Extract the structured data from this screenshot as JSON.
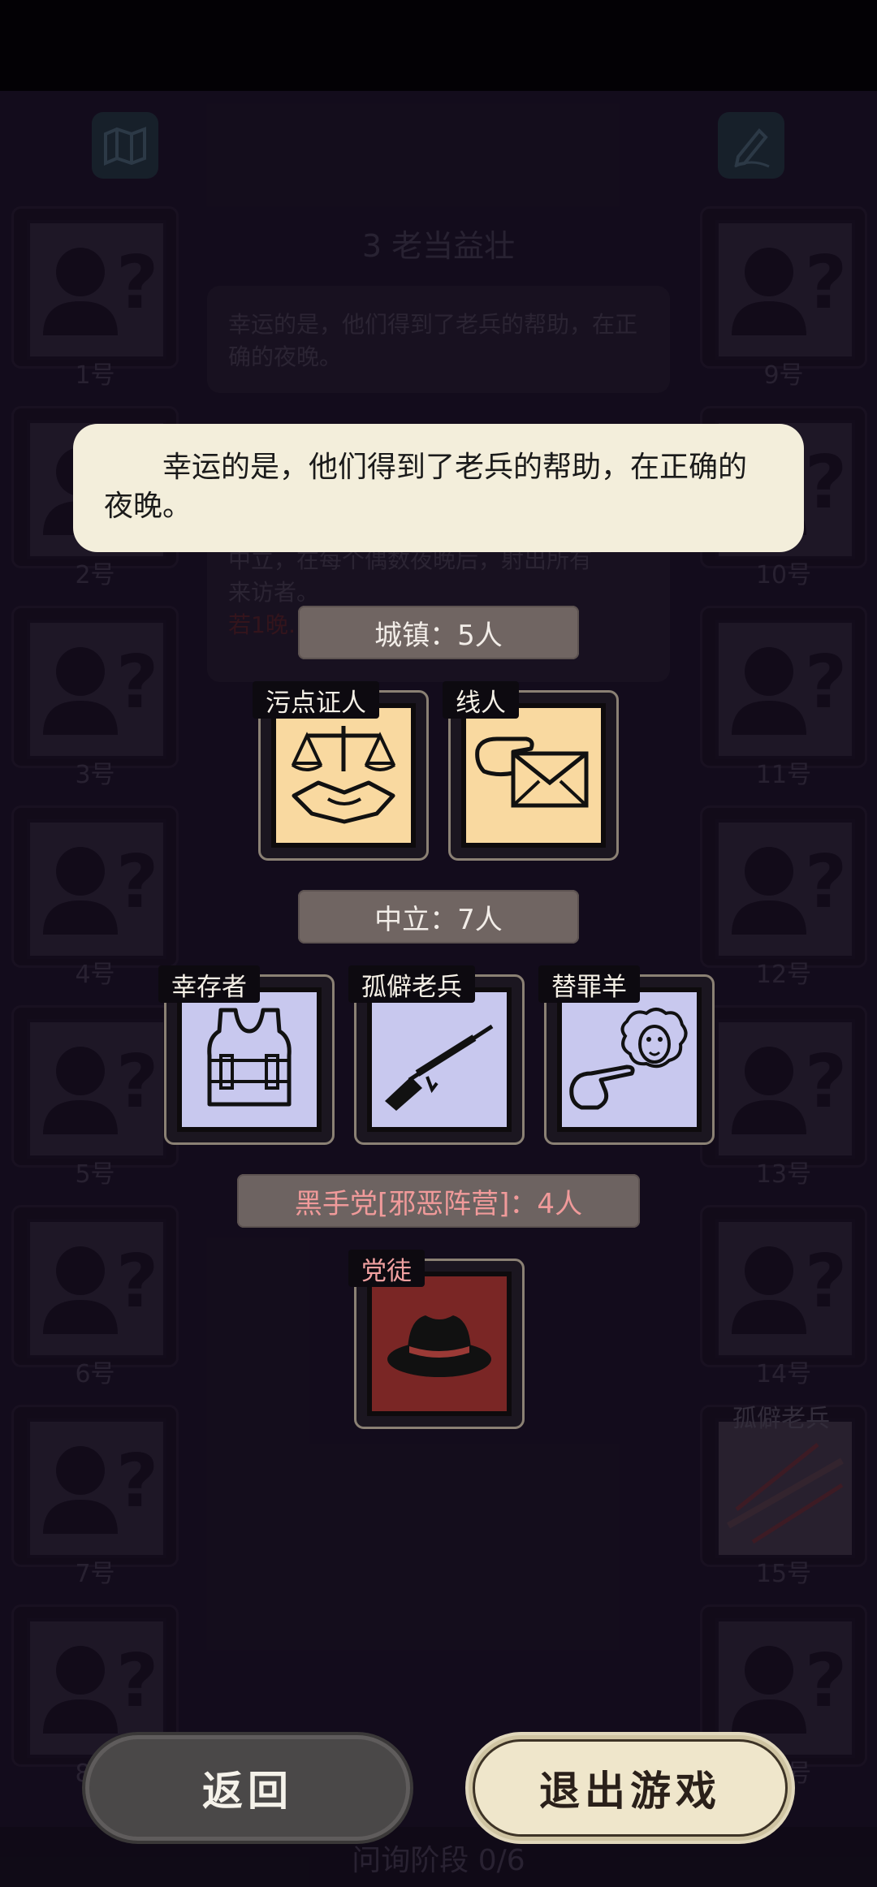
{
  "board": {
    "chapter_title": "3  老当益壮",
    "story_preview": "幸运的是，他们得到了老兵的帮助，在正确的夜晚。",
    "role_desc_line1": "中立，在每个偶数夜晚后，射出所有",
    "role_desc_line2": "来访者。",
    "role_desc_red": "若1晚…                         …了他。",
    "left_seats": [
      "1号",
      "2号",
      "3号",
      "4号",
      "5号",
      "6号",
      "7号",
      "8号"
    ],
    "right_seats": [
      "9号",
      "10号",
      "11号",
      "12号",
      "13号",
      "14号",
      "15号",
      "16号"
    ],
    "seat15_role": "孤僻老兵",
    "phase": "问询阶段 0/6"
  },
  "dialog": {
    "message": "幸运的是，他们得到了老兵的帮助，在正确的夜晚。"
  },
  "factions": {
    "town": {
      "label": "城镇：5人",
      "roles": [
        {
          "name": "污点证人",
          "icon": "scales-handshake-icon"
        },
        {
          "name": "线人",
          "icon": "envelope-hand-icon"
        }
      ]
    },
    "neutral": {
      "label": "中立：7人",
      "roles": [
        {
          "name": "幸存者",
          "icon": "vest-icon"
        },
        {
          "name": "孤僻老兵",
          "icon": "rifle-icon"
        },
        {
          "name": "替罪羊",
          "icon": "sheep-finger-icon"
        }
      ]
    },
    "mafia": {
      "label": "黑手党[邪恶阵营]：4人",
      "roles": [
        {
          "name": "党徒",
          "icon": "fedora-hat-icon"
        }
      ]
    }
  },
  "buttons": {
    "back": "返回",
    "quit": "退出游戏"
  },
  "colors": {
    "town_card": "#f9d9a0",
    "neutral_card": "#c8c8ee",
    "mafia_card": "#7a2625",
    "mafia_label": "#f09a9a"
  }
}
